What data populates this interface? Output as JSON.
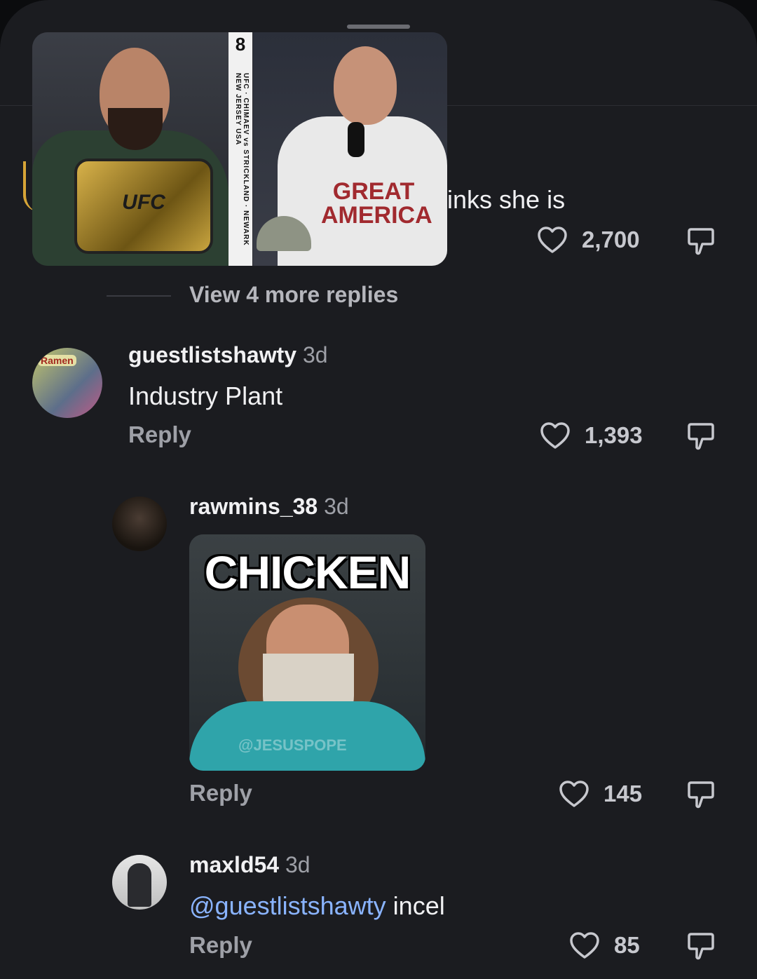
{
  "truncated_comment": {
    "text_fragment": "inks she is"
  },
  "top_media": {
    "strip_text": "UFC · CHIMAEV vs STRICKLAND · NEWARK NEW JERSEY USA",
    "strip_number": "8",
    "belt_text": "UFC",
    "shirt_text": "GREAT AMERICA"
  },
  "top_comment": {
    "likes": "2,700"
  },
  "view_more": "View 4 more replies",
  "comments": [
    {
      "username": "guestlistshawty",
      "time": "3d",
      "text": "Industry Plant",
      "reply_label": "Reply",
      "likes": "1,393",
      "avatar_label": "Ramen"
    },
    {
      "username": "rawmins_38",
      "time": "3d",
      "gif_caption": "CHICKEN",
      "gif_watermark": "@JESUSPOPE",
      "reply_label": "Reply",
      "likes": "145"
    },
    {
      "username": "maxld54",
      "time": "3d",
      "mention": "@guestlistshawty",
      "text": "incel",
      "reply_label": "Reply",
      "likes": "85"
    }
  ],
  "icons": {
    "like": "heart-icon",
    "dislike": "thumbs-down-icon"
  },
  "colors": {
    "background": "#1b1c20",
    "mention": "#8ab4ff",
    "secondary_text": "#9ea0a7"
  }
}
